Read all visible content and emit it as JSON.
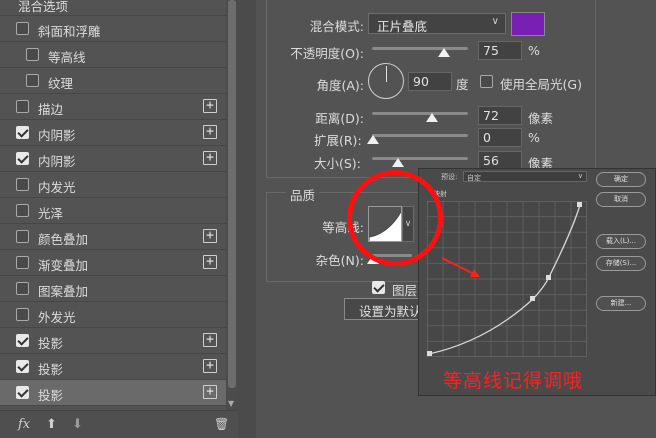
{
  "left_panel": {
    "header": "混合选项",
    "items": [
      {
        "label": "斜面和浮雕",
        "checked": false,
        "indent": false,
        "plus": false
      },
      {
        "label": "等高线",
        "checked": false,
        "indent": true,
        "plus": false
      },
      {
        "label": "纹理",
        "checked": false,
        "indent": true,
        "plus": false
      },
      {
        "label": "描边",
        "checked": false,
        "indent": false,
        "plus": true
      },
      {
        "label": "内阴影",
        "checked": true,
        "indent": false,
        "plus": true
      },
      {
        "label": "内阴影",
        "checked": true,
        "indent": false,
        "plus": true
      },
      {
        "label": "内发光",
        "checked": false,
        "indent": false,
        "plus": false
      },
      {
        "label": "光泽",
        "checked": false,
        "indent": false,
        "plus": false
      },
      {
        "label": "颜色叠加",
        "checked": false,
        "indent": false,
        "plus": true
      },
      {
        "label": "渐变叠加",
        "checked": false,
        "indent": false,
        "plus": true
      },
      {
        "label": "图案叠加",
        "checked": false,
        "indent": false,
        "plus": false
      },
      {
        "label": "外发光",
        "checked": false,
        "indent": false,
        "plus": false
      },
      {
        "label": "投影",
        "checked": true,
        "indent": false,
        "plus": true
      },
      {
        "label": "投影",
        "checked": true,
        "indent": false,
        "plus": true
      },
      {
        "label": "投影",
        "checked": true,
        "indent": false,
        "plus": true
      }
    ],
    "footer": {
      "fx": "fx",
      "up": "⬆",
      "down": "⬇",
      "trash": "🗑"
    }
  },
  "structure": {
    "blend_mode_label": "混合模式:",
    "blend_mode_value": "正片叠底",
    "color_swatch": "#7a1fb3",
    "opacity_label": "不透明度(O):",
    "opacity_value": "75",
    "opacity_unit": "%",
    "opacity_level": 0.75,
    "angle_label": "角度(A):",
    "angle_value": "90",
    "angle_unit": "度",
    "global_light_label": "使用全局光(G)",
    "global_light_checked": false,
    "distance_label": "距离(D):",
    "distance_value": "72",
    "distance_unit": "像素",
    "spread_label": "扩展(R):",
    "spread_value": "0",
    "spread_unit": "%",
    "size_label": "大小(S):",
    "size_value": "56",
    "size_unit": "像素"
  },
  "quality": {
    "title": "品质",
    "contour_label": "等高线:",
    "noise_label": "杂色(N):",
    "layer_knockout_label": "图层",
    "set_default_button": "设置为默认"
  },
  "contour_editor": {
    "preset_label": "预设:",
    "preset_value": "自定",
    "mapping_label": "映射",
    "buttons": [
      "确定",
      "取消",
      "载入(L)...",
      "存储(S)...",
      "新建..."
    ]
  },
  "annotation": {
    "note": "等高线记得调哦",
    "highlight_color": "#ff1010"
  }
}
